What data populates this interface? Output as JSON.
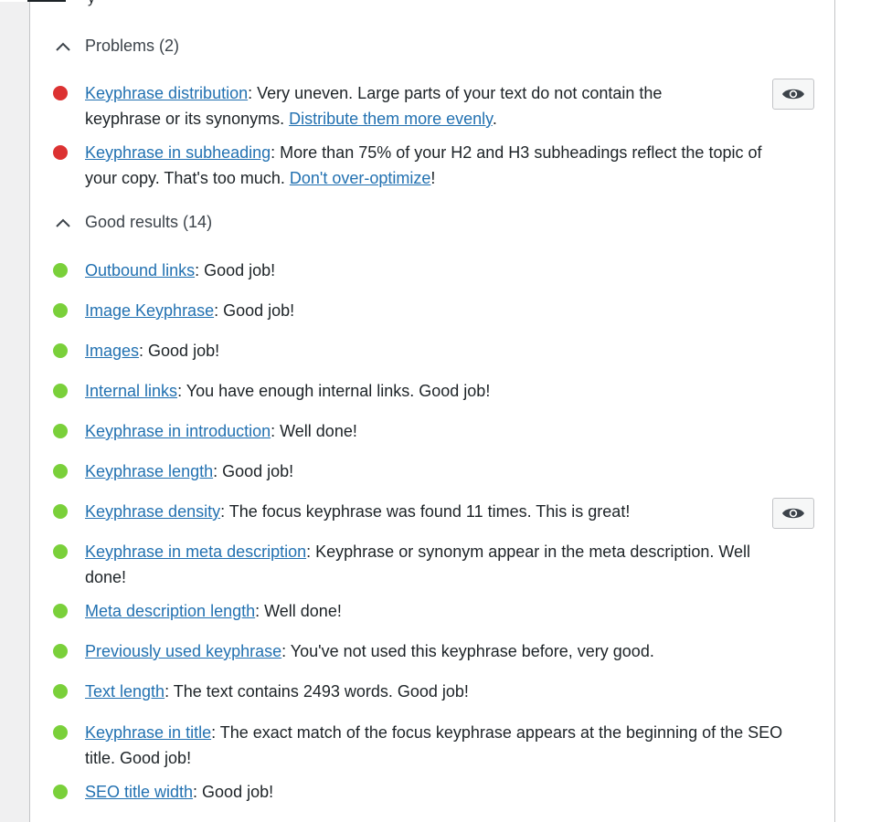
{
  "problems": {
    "header": "Problems (2)",
    "items": [
      {
        "link": "Keyphrase distribution",
        "text": ": Very uneven. Large parts of your text do not contain the keyphrase or its synonyms. ",
        "link2": "Distribute them more evenly",
        "tail": "."
      },
      {
        "link": "Keyphrase in subheading",
        "text": ": More than 75% of your H2 and H3 subheadings reflect the topic of your copy. That's too much. ",
        "link2": "Don't over-optimize",
        "tail": "!"
      }
    ]
  },
  "good": {
    "header": "Good results (14)",
    "items": [
      {
        "link": "Outbound links",
        "text": ": Good job!"
      },
      {
        "link": "Image Keyphrase",
        "text": ": Good job!"
      },
      {
        "link": "Images",
        "text": ": Good job!"
      },
      {
        "link": "Internal links",
        "text": ": You have enough internal links. Good job!"
      },
      {
        "link": "Keyphrase in introduction",
        "text": ": Well done!"
      },
      {
        "link": "Keyphrase length",
        "text": ": Good job!"
      },
      {
        "link": "Keyphrase density",
        "text": ": The focus keyphrase was found 11 times. This is great!"
      },
      {
        "link": "Keyphrase in meta description",
        "text": ": Keyphrase or synonym appear in the meta description. Well done!"
      },
      {
        "link": "Meta description length",
        "text": ": Well done!"
      },
      {
        "link": "Previously used keyphrase",
        "text": ": You've not used this keyphrase before, very good."
      },
      {
        "link": "Text length",
        "text": ": The text contains 2493 words. Good job!"
      },
      {
        "link": "Keyphrase in title",
        "text": ": The exact match of the focus keyphrase appears at the beginning of the SEO title. Good job!"
      },
      {
        "link": "SEO title width",
        "text": ": Good job!"
      }
    ]
  },
  "icons": {
    "chevron": "chevron-up-icon",
    "eye": "eye-icon",
    "problem_bullet": "red-bullet-icon",
    "good_bullet": "green-bullet-icon"
  },
  "colors": {
    "problem": "#dc3232",
    "good": "#7ad03a",
    "link": "#2271b1"
  }
}
